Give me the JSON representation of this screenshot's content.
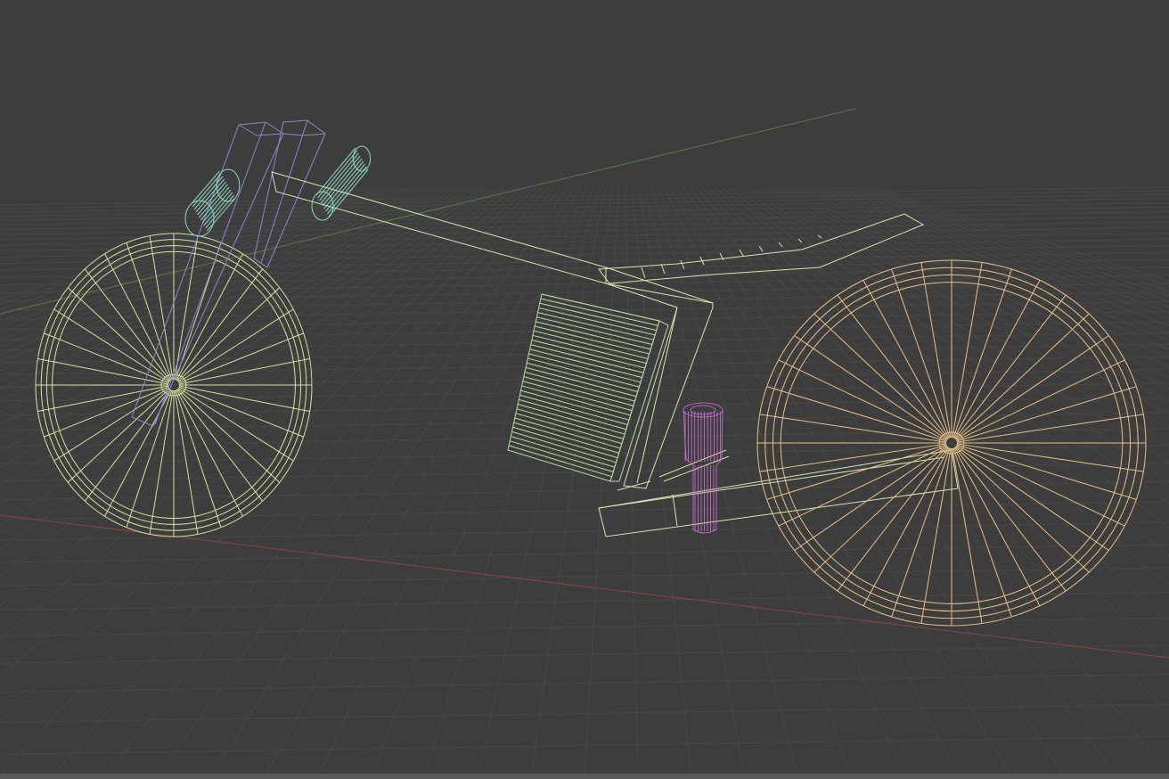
{
  "viewport": {
    "mode": "wireframe",
    "background": "#3d3d3d",
    "grid_color": "#474747",
    "x_axis_color": "#8c4444",
    "y_axis_color": "#5a7a4a"
  },
  "objects": [
    {
      "name": "front-wheel",
      "color": "#d9e0a0"
    },
    {
      "name": "front-fork",
      "color": "#8d86c9"
    },
    {
      "name": "handlebar",
      "color": "#8fd6c0"
    },
    {
      "name": "frame-top-tube",
      "color": "#d6e6b0"
    },
    {
      "name": "seat",
      "color": "#d6e6b0"
    },
    {
      "name": "battery",
      "color": "#b8dca0"
    },
    {
      "name": "pedal-crank",
      "color": "#d070d8"
    },
    {
      "name": "swing-arm",
      "color": "#d6e6b0"
    },
    {
      "name": "rear-wheel",
      "color": "#e8c08a"
    }
  ]
}
